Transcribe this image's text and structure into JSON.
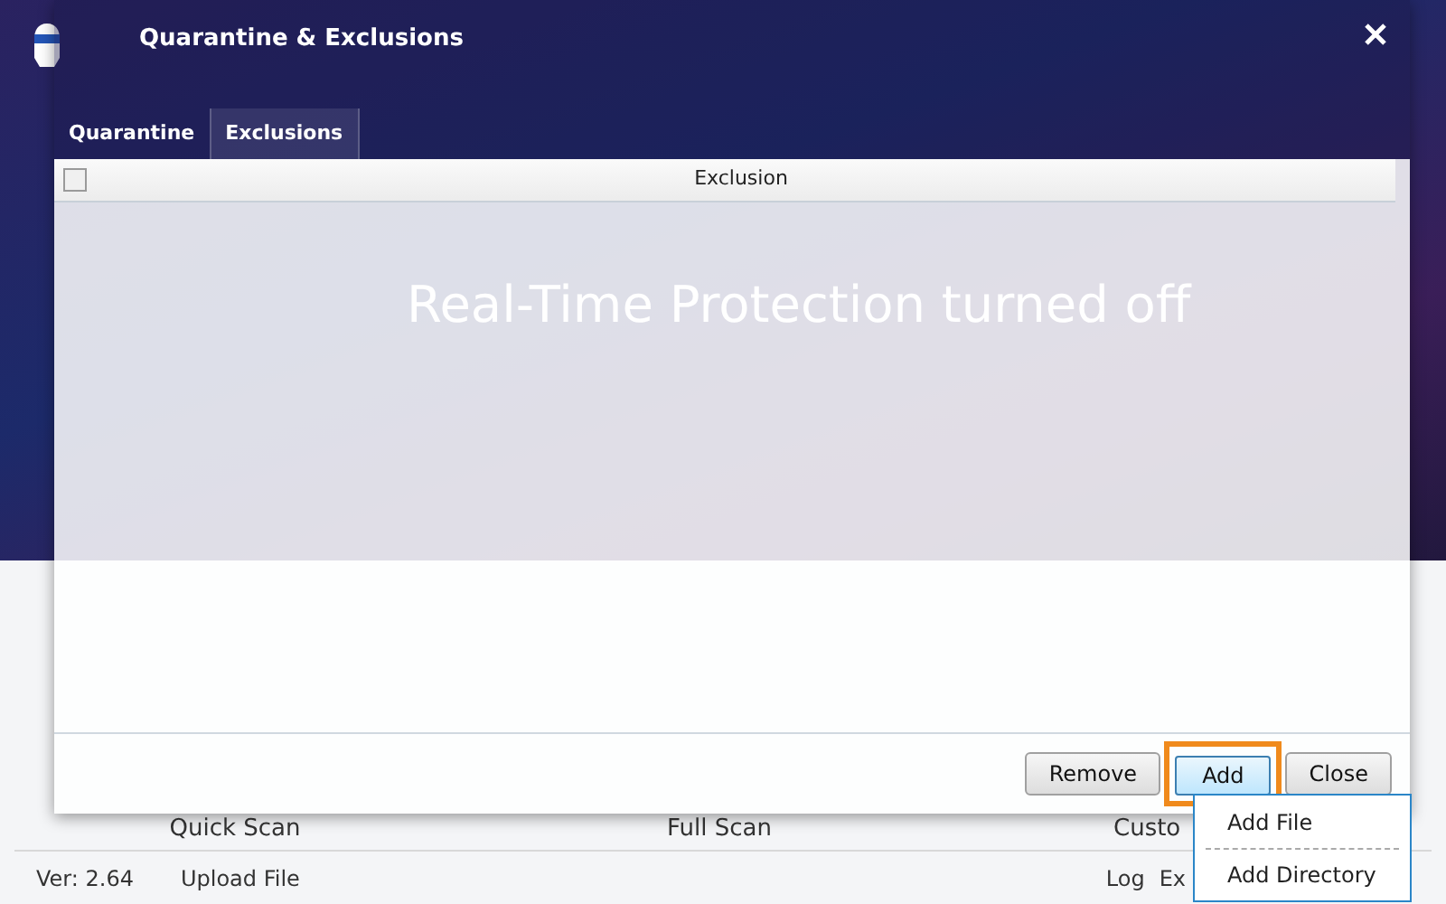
{
  "app": {
    "status_text": "Real-Time Protection turned off",
    "scan_options": [
      {
        "label": "Quick Scan"
      },
      {
        "label": "Full Scan"
      },
      {
        "label": "Custo"
      }
    ],
    "footer": {
      "version": "Ver: 2.64",
      "left_links": [
        "Upload File"
      ],
      "right_links": [
        "Log",
        "Ex"
      ]
    }
  },
  "dialog": {
    "title": "Quarantine & Exclusions",
    "tabs": [
      {
        "label": "Quarantine",
        "selected": false
      },
      {
        "label": "Exclusions",
        "selected": true
      }
    ],
    "table": {
      "select_all_checked": false,
      "columns": [
        "Exclusion"
      ]
    },
    "buttons": [
      {
        "label": "Remove",
        "highlighted": false
      },
      {
        "label": "Add",
        "highlighted": true
      },
      {
        "label": "Close",
        "highlighted": false
      }
    ]
  },
  "menu": {
    "items": [
      "Add File",
      "Add Directory"
    ]
  }
}
